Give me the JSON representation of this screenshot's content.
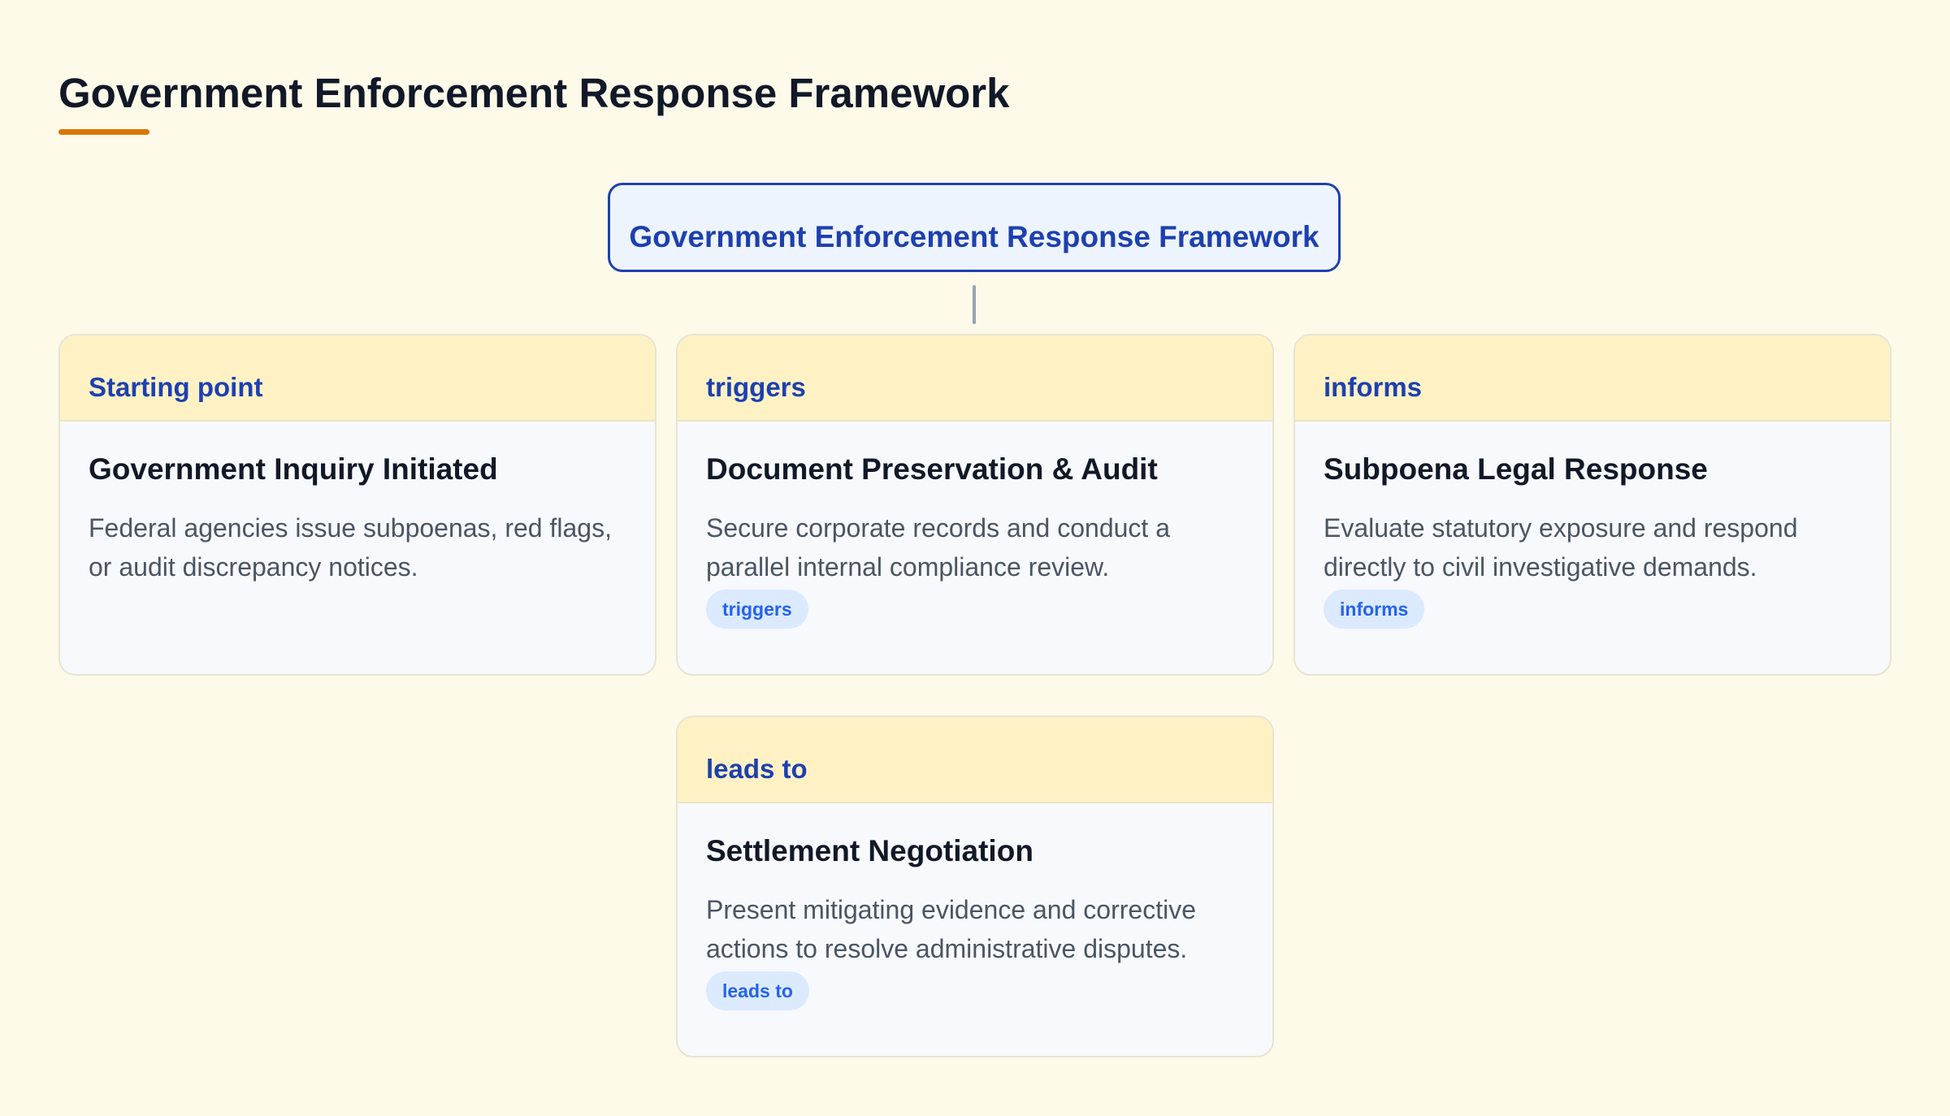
{
  "header": {
    "title": "Government Enforcement Response Framework"
  },
  "root": {
    "label": "Government Enforcement Response Framework"
  },
  "cards": [
    {
      "tag": "Starting point",
      "title": "Government Inquiry Initiated",
      "description": "Federal agencies issue subpoenas, red flags, or audit discrepancy notices.",
      "badge": ""
    },
    {
      "tag": "triggers",
      "title": "Document Preservation & Audit",
      "description": "Secure corporate records and conduct a parallel internal compliance review.",
      "badge": "triggers"
    },
    {
      "tag": "informs",
      "title": "Subpoena Legal Response",
      "description": "Evaluate statutory exposure and respond directly to civil investigative demands.",
      "badge": "informs"
    },
    {
      "tag": "leads to",
      "title": "Settlement Negotiation",
      "description": "Present mitigating evidence and corrective actions to resolve administrative disputes.",
      "badge": "leads to"
    }
  ],
  "colors": {
    "background": "#fefae9",
    "accent_underline": "#d97706",
    "primary_blue": "#1e40af",
    "card_header": "#fef2c5",
    "card_body": "#f7f9fc",
    "badge_bg": "#dbeafe",
    "badge_text": "#2563eb"
  }
}
